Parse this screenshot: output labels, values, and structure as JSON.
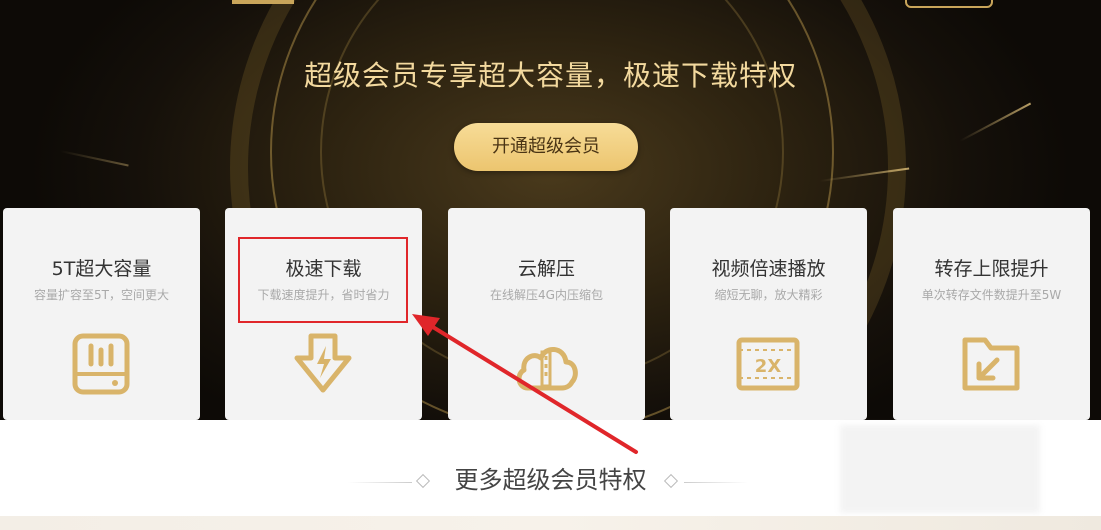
{
  "hero": {
    "headline": "超级会员专享超大容量，极速下载特权",
    "cta_label": "开通超级会员"
  },
  "cards": [
    {
      "title": "5T超大容量",
      "subtitle": "容量扩容至5T，空间更大",
      "icon": "storage-drive-icon"
    },
    {
      "title": "极速下载",
      "subtitle": "下载速度提升，省时省力",
      "icon": "download-bolt-icon"
    },
    {
      "title": "云解压",
      "subtitle": "在线解压4G内压缩包",
      "icon": "cloud-zip-icon"
    },
    {
      "title": "视频倍速播放",
      "subtitle": "缩短无聊，放大精彩",
      "icon": "video-2x-icon"
    },
    {
      "title": "转存上限提升",
      "subtitle": "单次转存文件数提升至5W",
      "icon": "folder-transfer-icon"
    }
  ],
  "more_section": {
    "title": "更多超级会员特权"
  },
  "colors": {
    "gold_text": "#f3d99e",
    "gold_icon": "#d9b46a",
    "cta_bg": "#f0cc7e",
    "highlight_red": "#e0262a",
    "card_bg": "#f3f3f3"
  }
}
